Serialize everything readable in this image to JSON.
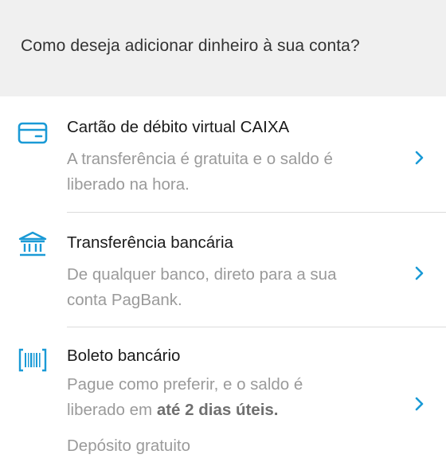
{
  "header": {
    "title": "Como deseja adicionar dinheiro à sua conta?"
  },
  "options": [
    {
      "icon": "credit-card-icon",
      "title": "Cartão de débito virtual CAIXA",
      "desc_line1": "A transferência é gratuita e o saldo é",
      "desc_line2": "liberado na hora."
    },
    {
      "icon": "bank-icon",
      "title": "Transferência bancária",
      "desc_line1": "De qualquer banco, direto para a sua",
      "desc_line2": "conta PagBank."
    },
    {
      "icon": "barcode-icon",
      "title": "Boleto bancário",
      "desc_line1": "Pague como preferir, e o saldo é",
      "desc_line2_prefix": "liberado em ",
      "desc_line2_bold": "até 2 dias úteis.",
      "footnote": "Depósito gratuito"
    }
  ],
  "colors": {
    "accent": "#1a9ad6",
    "header_bg": "#f0f0f0",
    "title_text": "#1a1a1a",
    "secondary_text": "#9a9a9a",
    "divider": "#dcdcdc"
  }
}
